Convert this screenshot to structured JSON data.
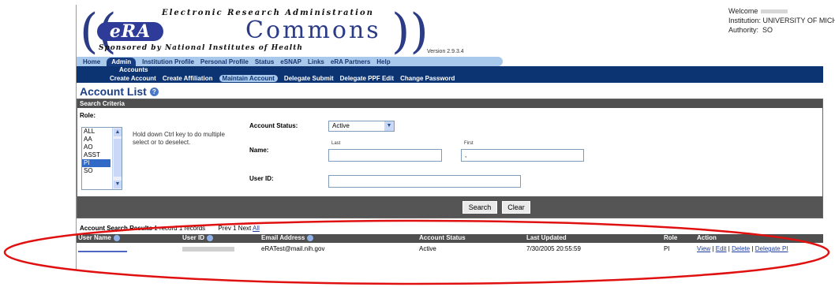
{
  "header": {
    "tagline_top": "Electronic Research Administration",
    "brand_era": "eRA",
    "brand_commons": "Commons",
    "tagline_bottom": "Sponsored by National Institutes of Health",
    "version": "Version 2.9.3.4"
  },
  "user_info": {
    "welcome_label": "Welcome",
    "institution_label": "Institution:",
    "institution_value": "UNIVERSITY OF MICHIGA",
    "authority_label": "Authority:",
    "authority_value": "SO"
  },
  "main_nav": [
    {
      "label": "Home"
    },
    {
      "label": "Admin",
      "active": true
    },
    {
      "label": "Institution Profile"
    },
    {
      "label": "Personal Profile"
    },
    {
      "label": "Status"
    },
    {
      "label": "eSNAP"
    },
    {
      "label": "Links"
    },
    {
      "label": "eRA Partners"
    },
    {
      "label": "Help"
    }
  ],
  "sub_nav_1": {
    "label": "Accounts"
  },
  "sub_nav_2": [
    {
      "label": "Create Account"
    },
    {
      "label": "Create Affiliation"
    },
    {
      "label": "Maintain Account",
      "active": true
    },
    {
      "label": "Delegate Submit"
    },
    {
      "label": "Delegate PPF Edit"
    },
    {
      "label": "Change Password"
    }
  ],
  "page_title": "Account List",
  "search": {
    "header": "Search Criteria",
    "role_label": "Role:",
    "role_options": [
      "ALL",
      "AA",
      "AO",
      "ASST",
      "PI",
      "SO"
    ],
    "role_selected": "PI",
    "hint": "Hold down Ctrl key to do multiple select or to deselect.",
    "status_label": "Account Status:",
    "status_value": "Active",
    "name_label": "Name:",
    "last_label": "Last",
    "first_label": "First",
    "last_value": "",
    "first_value": ",",
    "userid_label": "User ID:",
    "userid_value": "",
    "search_button": "Search",
    "clear_button": "Clear"
  },
  "results": {
    "title": "Account Search Results",
    "record_text": "1 record 1 records",
    "pager_prev": "Prev",
    "pager_page": "1",
    "pager_next": "Next",
    "pager_all": "All",
    "columns": [
      "User Name",
      "User ID",
      "Email Address",
      "Account Status",
      "Last Updated",
      "Role",
      "Action"
    ],
    "rows": [
      {
        "email": "eRATest@mail.nih.gov",
        "status": "Active",
        "updated": "7/30/2005 20:55:59",
        "role": "PI",
        "actions": [
          "View",
          "Edit",
          "Delete",
          "Delegate PI"
        ]
      }
    ]
  },
  "colors": {
    "nav_dark": "#0c3473",
    "nav_light": "#a8c8ec",
    "panel_header": "#4f4f4f",
    "link": "#1f3ea0",
    "highlight_oval": "#e01010"
  }
}
